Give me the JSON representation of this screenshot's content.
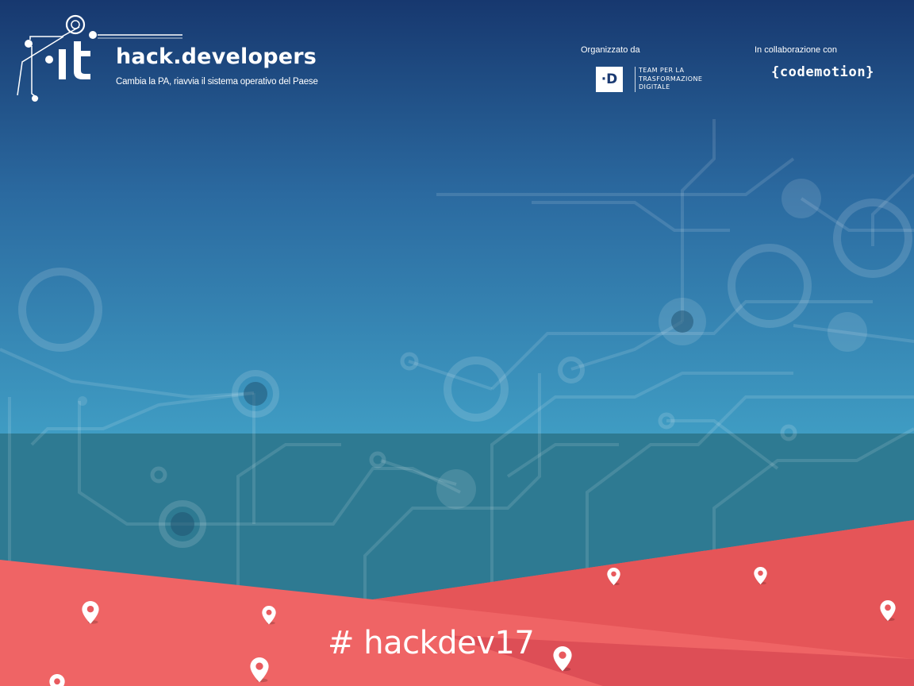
{
  "header": {
    "brand_name": "hack.developers",
    "tagline": "Cambia la PA, riavvia il sistema operativo del Paese",
    "logo_icon": "it-circuit-logo"
  },
  "organizers": {
    "organized_label": "Organizzato da",
    "team_badge": "·D",
    "team_lines": [
      "TEAM PER LA",
      "TRASFORMAZIONE",
      "DIGITALE"
    ],
    "collab_label": "In collaborazione con",
    "partner_name": "{codemotion}"
  },
  "footer": {
    "hashtag": "# hackdev17",
    "pin_icon": "map-pin-icon"
  },
  "colors": {
    "sky_top": "#17386f",
    "sky_mid": "#2b6aa0",
    "sky_bottom": "#3f9cc3",
    "teal_band": "#2e7a92",
    "coral": "#ef6465",
    "coral_dark": "#d64450",
    "white": "#ffffff"
  }
}
